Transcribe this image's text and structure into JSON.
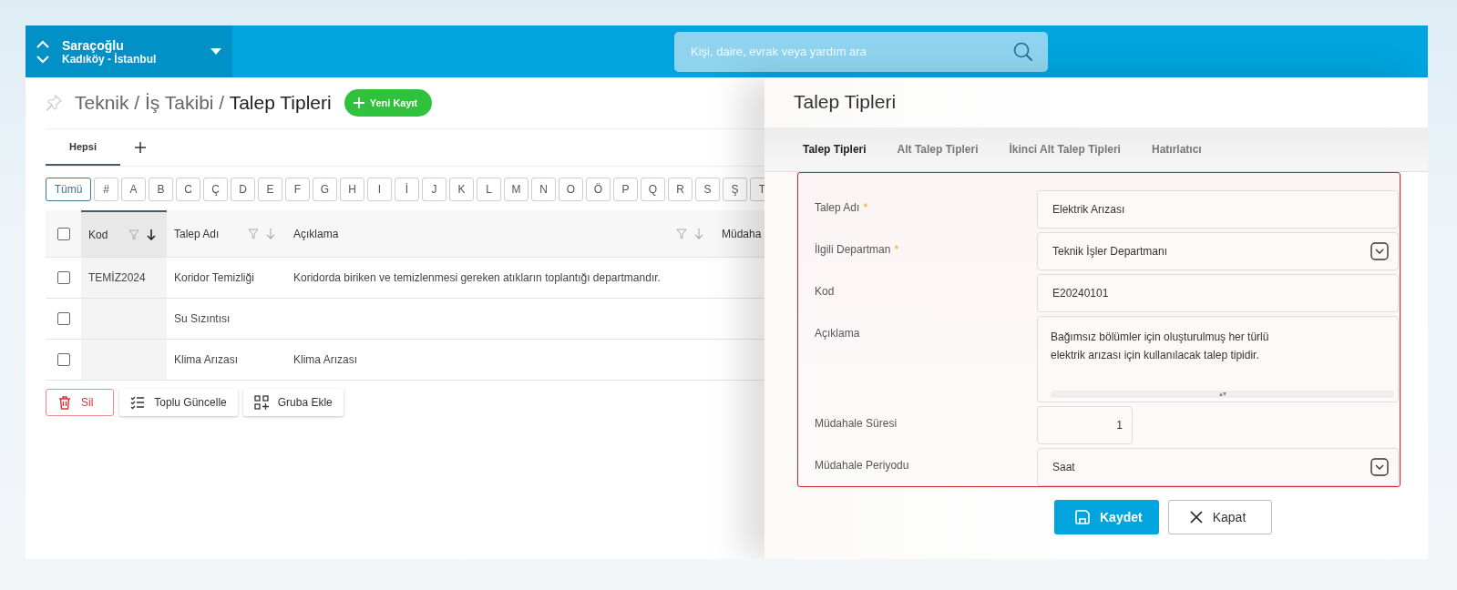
{
  "topbar": {
    "account": {
      "name": "Saraçoğlu",
      "location": "Kadıköy - İstanbul"
    },
    "search": {
      "placeholder": "Kişi, daire, evrak veya yardım ara"
    }
  },
  "page": {
    "breadcrumb": "Teknik / İş Takibi / **Talep Tipleri**",
    "new_button": "Yeni Kayıt",
    "tabs": [
      {
        "label": "Hepsi",
        "selected": true
      }
    ],
    "letters": [
      {
        "label": "Tümü",
        "selected": true
      },
      {
        "label": "#",
        "selected": false
      },
      {
        "label": "A",
        "selected": false
      },
      {
        "label": "B",
        "selected": false
      },
      {
        "label": "C",
        "selected": false
      },
      {
        "label": "Ç",
        "selected": false
      },
      {
        "label": "D",
        "selected": false
      },
      {
        "label": "E",
        "selected": false
      },
      {
        "label": "F",
        "selected": false
      },
      {
        "label": "G",
        "selected": false
      },
      {
        "label": "H",
        "selected": false
      },
      {
        "label": "I",
        "selected": false
      },
      {
        "label": "İ",
        "selected": false
      },
      {
        "label": "J",
        "selected": false
      },
      {
        "label": "K",
        "selected": false
      },
      {
        "label": "L",
        "selected": false
      },
      {
        "label": "M",
        "selected": false
      },
      {
        "label": "N",
        "selected": false
      },
      {
        "label": "O",
        "selected": false
      },
      {
        "label": "Ö",
        "selected": false
      },
      {
        "label": "P",
        "selected": false
      },
      {
        "label": "Q",
        "selected": false
      },
      {
        "label": "R",
        "selected": false
      },
      {
        "label": "S",
        "selected": false
      },
      {
        "label": "Ş",
        "selected": false
      },
      {
        "label": "T",
        "selected": false
      }
    ],
    "table": {
      "select_all": {
        "checked": false
      },
      "columns": [
        {
          "label": "Kod",
          "sorted": true
        },
        {
          "label": "Talep Adı",
          "sorted": false
        },
        {
          "label": "Açıklama",
          "sorted": false
        },
        {
          "label": "Müdaha",
          "sorted": false
        }
      ],
      "rows": [
        {
          "checked": false,
          "cells": [
            "TEMİZ2024",
            "Koridor Temizliği",
            "Koridorda biriken ve temizlenmesi gereken atıkların toplantığı departmandır."
          ]
        },
        {
          "checked": false,
          "cells": [
            "",
            "Su Sızıntısı",
            ""
          ]
        },
        {
          "checked": false,
          "cells": [
            "",
            "Klima Arızası",
            "Klima Arızası"
          ]
        }
      ]
    },
    "actions": [
      {
        "label": "Sil",
        "kind": "delete"
      },
      {
        "label": "Toplu Güncelle",
        "kind": "bulk"
      },
      {
        "label": "Gruba Ekle",
        "kind": "group"
      }
    ]
  },
  "panel": {
    "title": "Talep Tipleri",
    "tabs": [
      {
        "label": "Talep Tipleri",
        "selected": true
      },
      {
        "label": "Alt Talep Tipleri",
        "selected": false
      },
      {
        "label": "İkinci Alt Talep Tipleri",
        "selected": false
      },
      {
        "label": "Hatırlatıcı",
        "selected": false
      }
    ],
    "fields": [
      {
        "label": "Talep Adı",
        "marker": "*",
        "kind": "text",
        "value": "Elektrik Arızası"
      },
      {
        "label": "İlgili Departman",
        "marker": "*",
        "kind": "select",
        "value": "Teknik İşler Departmanı"
      },
      {
        "label": "Kod",
        "kind": "text",
        "value": "E20240101"
      },
      {
        "label": "Açıklama",
        "kind": "textarea",
        "value": "Bağımsız bölümler için oluşturulmuş her türlü elektrik arızası için kullanılacak talep tipidir."
      },
      {
        "label": "Müdahale Süresi",
        "kind": "number",
        "value": "1"
      },
      {
        "label": "Müdahale Periyodu",
        "kind": "select",
        "value": "Saat"
      }
    ],
    "buttons": [
      {
        "label": "Kaydet",
        "kind": "primary"
      },
      {
        "label": "Kapat",
        "kind": "secondary"
      }
    ]
  }
}
